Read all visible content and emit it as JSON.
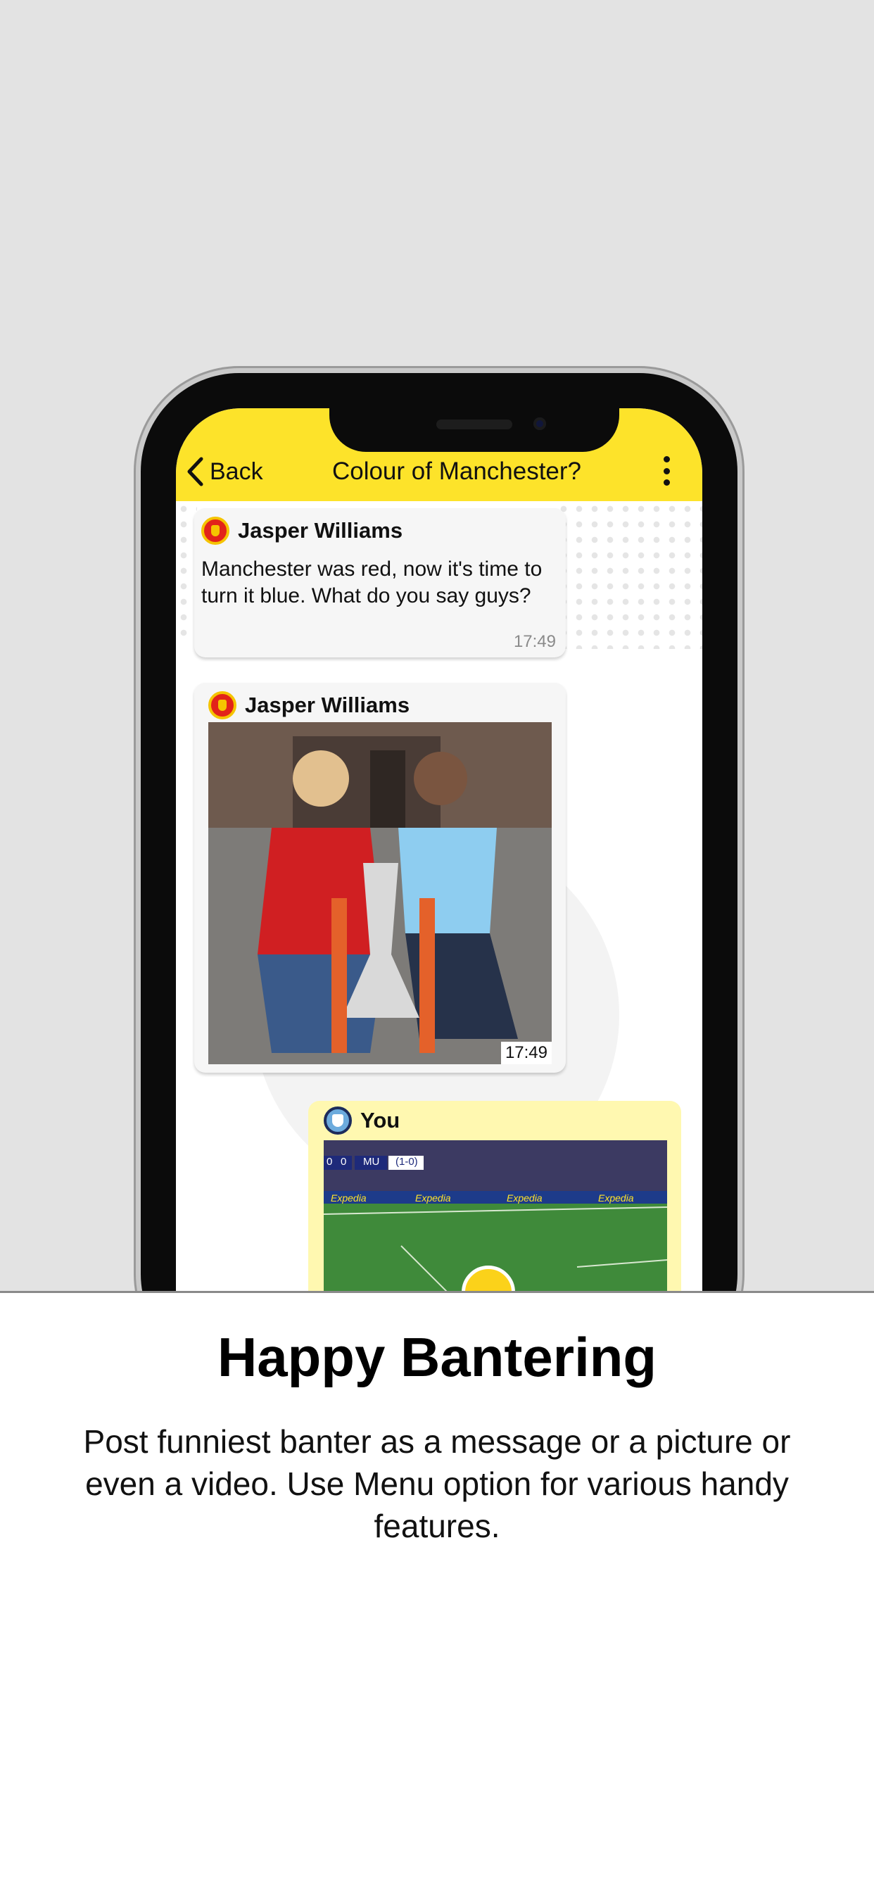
{
  "nav": {
    "back_label": "Back",
    "title": "Colour of Manchester?"
  },
  "messages": [
    {
      "sender": "Jasper Williams",
      "club_icon": "manchester-united-crest-icon",
      "text": "Manchester was red, now it's time to turn it blue. What do you say guys?",
      "time": "17:49"
    },
    {
      "sender": "Jasper Williams",
      "club_icon": "manchester-united-crest-icon",
      "media": "photo",
      "time": "17:49"
    },
    {
      "sender": "You",
      "club_icon": "manchester-city-crest-icon",
      "media": "video",
      "scoreboard": [
        "0",
        "0",
        "MU",
        "(1-0)"
      ],
      "ad_text": "Expedia"
    }
  ],
  "caption": {
    "title": "Happy Bantering",
    "body": "Post funniest banter as a message or a picture or even a video. Use Menu option for various handy features."
  },
  "colors": {
    "nav_background": "#fde32a",
    "own_bubble": "#fff8b0",
    "incoming_bubble": "#f6f6f6"
  }
}
